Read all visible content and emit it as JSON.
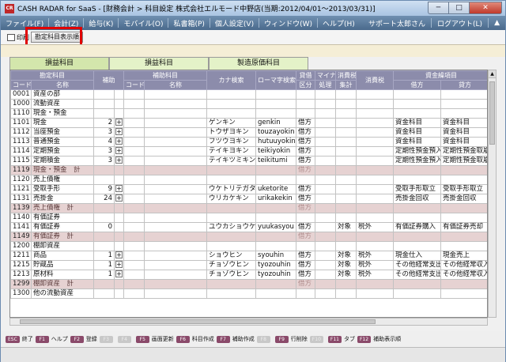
{
  "window": {
    "title": "CASH RADAR for SaaS - [財務会計 > 科目設定 株式会社エルモード中野店(当期:2012/04/01～2013/03/31)]",
    "icon": "cr-app-icon",
    "min": "─",
    "max": "□",
    "close": "✕"
  },
  "menu": {
    "items": [
      "ファイル(F)",
      "会計(Z)",
      "給与(K)",
      "モバイル(O)",
      "私書箱(P)",
      "個人設定(V)",
      "ウィンドウ(W)",
      "ヘルプ(H)"
    ],
    "right": [
      "サポート太郎さん",
      "ログアウト(L)",
      "▲"
    ]
  },
  "toolbar": {
    "print": "印刷",
    "order": "勘定科目表示順"
  },
  "tabs": [
    "損益科目",
    "損益科目",
    "製造原価科目"
  ],
  "grid": {
    "groups": {
      "kanjo": "勘定科目",
      "hosetsu": "補助",
      "hojo": "補助科目",
      "kana": "カナ検索",
      "roma": "ローマ字検索",
      "taishaku": "貸借",
      "mynus": "マイナス",
      "shohizei": "消費税",
      "shohi": "消費税",
      "shikin": "資金繰項目"
    },
    "sub": {
      "code": "コード",
      "name": "名称",
      "hcode": "コード",
      "hname": "名称",
      "taishaku": "区分",
      "mynus": "処理",
      "shukei": "集計",
      "debit": "借方",
      "credit": "貸方"
    },
    "rows": [
      {
        "t": "n",
        "code": "0001",
        "name": "資産の部",
        "kana": "",
        "roma": "",
        "kubun": "",
        "hojo": "",
        "plus": false,
        "taisho": "",
        "zei": "",
        "debit": "",
        "credit": ""
      },
      {
        "t": "n",
        "code": "1000",
        "name": "流動資産",
        "kana": "",
        "roma": "",
        "kubun": "",
        "hojo": "",
        "plus": false,
        "taisho": "",
        "zei": "",
        "debit": "",
        "credit": ""
      },
      {
        "t": "n",
        "code": "1110",
        "name": "現金・預金",
        "kana": "",
        "roma": "",
        "kubun": "",
        "hojo": "",
        "plus": false,
        "taisho": "",
        "zei": "",
        "debit": "",
        "credit": ""
      },
      {
        "t": "n",
        "code": "1101",
        "name": "現金",
        "hojo": "2",
        "plus": true,
        "kana": "ゲンキン",
        "roma": "genkin",
        "kubun": "借方",
        "taisho": "",
        "zei": "",
        "debit": "資金科目",
        "credit": "資金科目"
      },
      {
        "t": "n",
        "code": "1112",
        "name": "当座預金",
        "hojo": "3",
        "plus": true,
        "kana": "トウザヨキン",
        "roma": "touzayokin",
        "kubun": "借方",
        "taisho": "",
        "zei": "",
        "debit": "資金科目",
        "credit": "資金科目"
      },
      {
        "t": "n",
        "code": "1113",
        "name": "普通預金",
        "hojo": "4",
        "plus": true,
        "kana": "フツウヨキン",
        "roma": "hutuuyokin",
        "kubun": "借方",
        "taisho": "",
        "zei": "",
        "debit": "資金科目",
        "credit": "資金科目"
      },
      {
        "t": "n",
        "code": "1114",
        "name": "定期預金",
        "hojo": "3",
        "plus": true,
        "kana": "テイキヨキン",
        "roma": "teikiyokin",
        "kubun": "借方",
        "taisho": "",
        "zei": "",
        "debit": "定期性預金預入",
        "credit": "定期性預金取崩"
      },
      {
        "t": "n",
        "code": "1115",
        "name": "定期積金",
        "hojo": "3",
        "plus": true,
        "kana": "テイキツミキン",
        "roma": "teikitumi",
        "kubun": "借方",
        "taisho": "",
        "zei": "",
        "debit": "定期性預金預入",
        "credit": "定期性預金取崩"
      },
      {
        "t": "s",
        "code": "1119",
        "name": "現金・預金　計",
        "kana": "",
        "roma": "",
        "kubun": "借方",
        "hojo": "",
        "plus": false,
        "taisho": "",
        "zei": "",
        "debit": "",
        "credit": ""
      },
      {
        "t": "n",
        "code": "1120",
        "name": "売上債権",
        "kana": "",
        "roma": "",
        "kubun": "",
        "hojo": "",
        "plus": false,
        "taisho": "",
        "zei": "",
        "debit": "",
        "credit": ""
      },
      {
        "t": "n",
        "code": "1121",
        "name": "受取手形",
        "hojo": "9",
        "plus": true,
        "kana": "ウケトリテガタ",
        "roma": "uketorite",
        "kubun": "借方",
        "taisho": "",
        "zei": "",
        "debit": "受取手形取立",
        "credit": "受取手形取立"
      },
      {
        "t": "n",
        "code": "1131",
        "name": "売掛金",
        "hojo": "24",
        "plus": true,
        "kana": "ウリカケキン",
        "roma": "urikakekin",
        "kubun": "借方",
        "taisho": "",
        "zei": "",
        "debit": "売掛金回収",
        "credit": "売掛金回収"
      },
      {
        "t": "s",
        "code": "1139",
        "name": "売上債権　計",
        "kana": "",
        "roma": "",
        "kubun": "借方",
        "hojo": "",
        "plus": false,
        "taisho": "",
        "zei": "",
        "debit": "",
        "credit": ""
      },
      {
        "t": "n",
        "code": "1140",
        "name": "有価証券",
        "kana": "",
        "roma": "",
        "kubun": "",
        "hojo": "",
        "plus": false,
        "taisho": "",
        "zei": "",
        "debit": "",
        "credit": ""
      },
      {
        "t": "n",
        "code": "1141",
        "name": "有価証券",
        "hojo": "0",
        "plus": false,
        "kana": "ユウカショウケン",
        "roma": "yuukasyou",
        "kubun": "借方",
        "taisho": "対象",
        "zei": "税外",
        "debit": "有価証券購入",
        "credit": "有価証券売却"
      },
      {
        "t": "s",
        "code": "1149",
        "name": "有価証券　計",
        "kana": "",
        "roma": "",
        "kubun": "借方",
        "hojo": "",
        "plus": false,
        "taisho": "",
        "zei": "",
        "debit": "",
        "credit": ""
      },
      {
        "t": "n",
        "code": "1200",
        "name": "棚卸資産",
        "kana": "",
        "roma": "",
        "kubun": "",
        "hojo": "",
        "plus": false,
        "taisho": "",
        "zei": "",
        "debit": "",
        "credit": ""
      },
      {
        "t": "n",
        "code": "1211",
        "name": "商品",
        "hojo": "1",
        "plus": true,
        "kana": "ショウヒン",
        "roma": "syouhin",
        "kubun": "借方",
        "taisho": "対象",
        "zei": "税外",
        "debit": "現金仕入",
        "credit": "現金売上"
      },
      {
        "t": "n",
        "code": "1215",
        "name": "貯蔵品",
        "hojo": "1",
        "plus": true,
        "kana": "チョゾウヒン",
        "roma": "tyozouhin",
        "kubun": "借方",
        "taisho": "対象",
        "zei": "税外",
        "debit": "その他経常支出",
        "credit": "その他経常収入"
      },
      {
        "t": "n",
        "code": "1213",
        "name": "原材料",
        "hojo": "1",
        "plus": true,
        "kana": "チョゾウヒン",
        "roma": "tyozouhin",
        "kubun": "借方",
        "taisho": "対象",
        "zei": "税外",
        "debit": "その他経常支出",
        "credit": "その他経常収入"
      },
      {
        "t": "s",
        "code": "1299",
        "name": "棚卸資産　計",
        "kana": "",
        "roma": "",
        "kubun": "借方",
        "hojo": "",
        "plus": false,
        "taisho": "",
        "zei": "",
        "debit": "",
        "credit": ""
      },
      {
        "t": "n",
        "code": "1300",
        "name": "他の流動資産",
        "kana": "",
        "roma": "",
        "kubun": "",
        "hojo": "",
        "plus": false,
        "taisho": "",
        "zei": "",
        "debit": "",
        "credit": ""
      }
    ]
  },
  "fkeys": [
    {
      "k": "ESC",
      "l": "終了",
      "on": true
    },
    {
      "k": "F1",
      "l": "ヘルプ",
      "on": true
    },
    {
      "k": "F2",
      "l": "登録",
      "on": true
    },
    {
      "k": "F3",
      "l": "",
      "on": false
    },
    {
      "k": "F4",
      "l": "",
      "on": false
    },
    {
      "k": "F5",
      "l": "画面更新",
      "on": true
    },
    {
      "k": "F6",
      "l": "科目作成",
      "on": true
    },
    {
      "k": "F7",
      "l": "補助作成",
      "on": true
    },
    {
      "k": "F8",
      "l": "",
      "on": false
    },
    {
      "k": "F9",
      "l": "行削除",
      "on": true
    },
    {
      "k": "F10",
      "l": "",
      "on": false
    },
    {
      "k": "F11",
      "l": "タブ",
      "on": true
    },
    {
      "k": "F12",
      "l": "補助表示順",
      "on": true
    }
  ]
}
